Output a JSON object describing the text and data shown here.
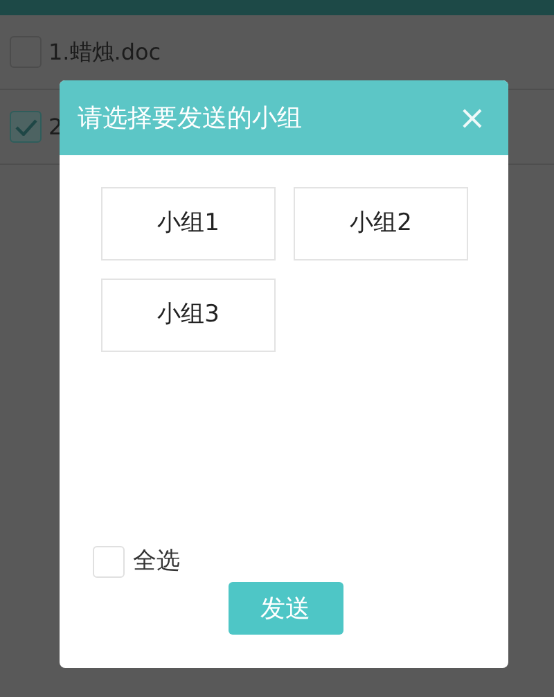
{
  "files": [
    {
      "label": "1.蜡烛.doc",
      "checked": false
    },
    {
      "label": "2",
      "checked": true
    }
  ],
  "dialog": {
    "title": "请选择要发送的小组",
    "close": "×",
    "groups": [
      {
        "label": "小组1",
        "selected": false
      },
      {
        "label": "小组2",
        "selected": false
      },
      {
        "label": "小组3",
        "selected": false
      }
    ],
    "select_all": {
      "label": "全选",
      "checked": false
    },
    "send_button": "发送"
  }
}
